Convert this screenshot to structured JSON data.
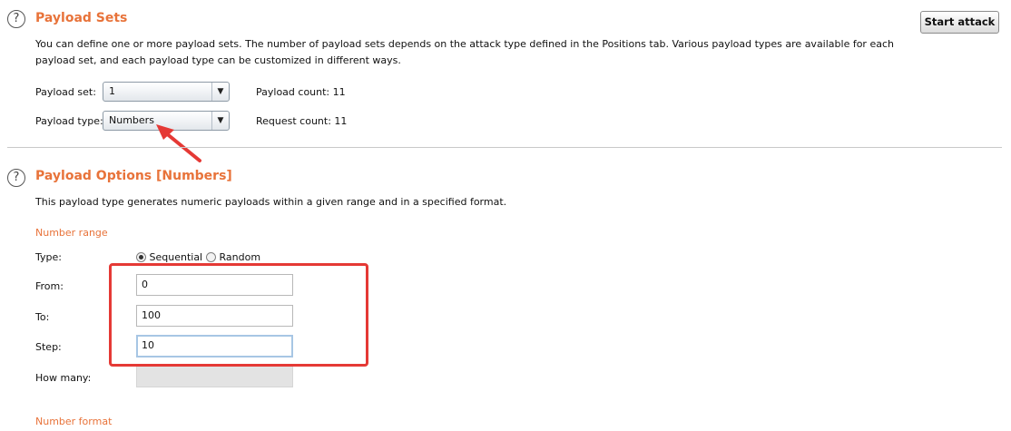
{
  "payload_sets": {
    "title": "Payload Sets",
    "description": "You can define one or more payload sets. The number of payload sets depends on the attack type defined in the Positions tab. Various payload types are available for each payload set, and each payload type can be customized in different ways.",
    "start_attack_label": "Start attack",
    "payload_set_label": "Payload set:",
    "payload_set_value": "1",
    "payload_type_label": "Payload type:",
    "payload_type_value": "Numbers",
    "payload_count": "Payload count:  11",
    "request_count": "Request count:  11"
  },
  "payload_options": {
    "title": "Payload Options [Numbers]",
    "description": "This payload type generates numeric payloads within a given range and in a specified format.",
    "number_range_title": "Number range",
    "type_label": "Type:",
    "sequential_label": "Sequential",
    "random_label": "Random",
    "from_label": "From:",
    "from_value": "0",
    "to_label": "To:",
    "to_value": "100",
    "step_label": "Step:",
    "step_value": "10",
    "how_many_label": "How many:",
    "number_format_title": "Number format"
  },
  "help_icon_glyph": "?",
  "colors": {
    "accent": "#e8733a",
    "annotation": "#e53935"
  }
}
